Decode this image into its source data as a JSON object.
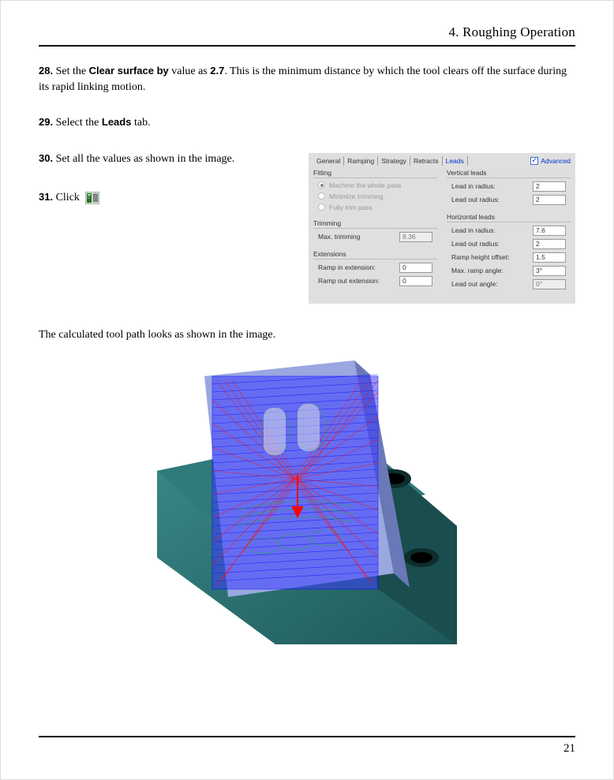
{
  "header": {
    "title": "4. Roughing Operation"
  },
  "steps": {
    "s28": {
      "num": "28.",
      "pre": "Set the ",
      "b1": "Clear surface by",
      "mid": " value as ",
      "b2": "2.7",
      "post": ". This is the minimum distance by which the tool clears off the surface during its rapid linking motion."
    },
    "s29": {
      "num": "29.",
      "pre": "Select the ",
      "b1": "Leads",
      "post": " tab."
    },
    "s30": {
      "num": "30.",
      "text": "Set all the values as shown in the image."
    },
    "s31": {
      "num": "31.",
      "text": "Click "
    }
  },
  "panel": {
    "tabs": [
      "General",
      "Ramping",
      "Strategy",
      "Retracts",
      "Leads"
    ],
    "advanced": "Advanced",
    "fitting": {
      "legend": "Fitting",
      "opt1": "Machine the whole pass",
      "opt2": "Minimize trimming",
      "opt3": "Fully trim pass"
    },
    "trimming": {
      "legend": "Trimming",
      "label": "Max. trimming",
      "value": "8.36"
    },
    "extensions": {
      "legend": "Extensions",
      "in_label": "Ramp in extension:",
      "in_val": "0",
      "out_label": "Ramp out extension:",
      "out_val": "0"
    },
    "vleads": {
      "legend": "Vertical leads",
      "in_label": "Lead in radius:",
      "in_val": "2",
      "out_label": "Lead out radius:",
      "out_val": "2"
    },
    "hleads": {
      "legend": "Horizontal leads",
      "in_label": "Lead in radius:",
      "in_val": "7.6",
      "out_label": "Lead out radius:",
      "out_val": "2",
      "ramp_label": "Ramp height offset:",
      "ramp_val": "1.5",
      "ang_label": "Max. ramp angle:",
      "ang_val": "3°",
      "lead_ang_label": "Lead out angle:",
      "lead_ang_val": "0°"
    }
  },
  "bottom_text": "The calculated tool path looks as shown in the image.",
  "page_number": "21"
}
